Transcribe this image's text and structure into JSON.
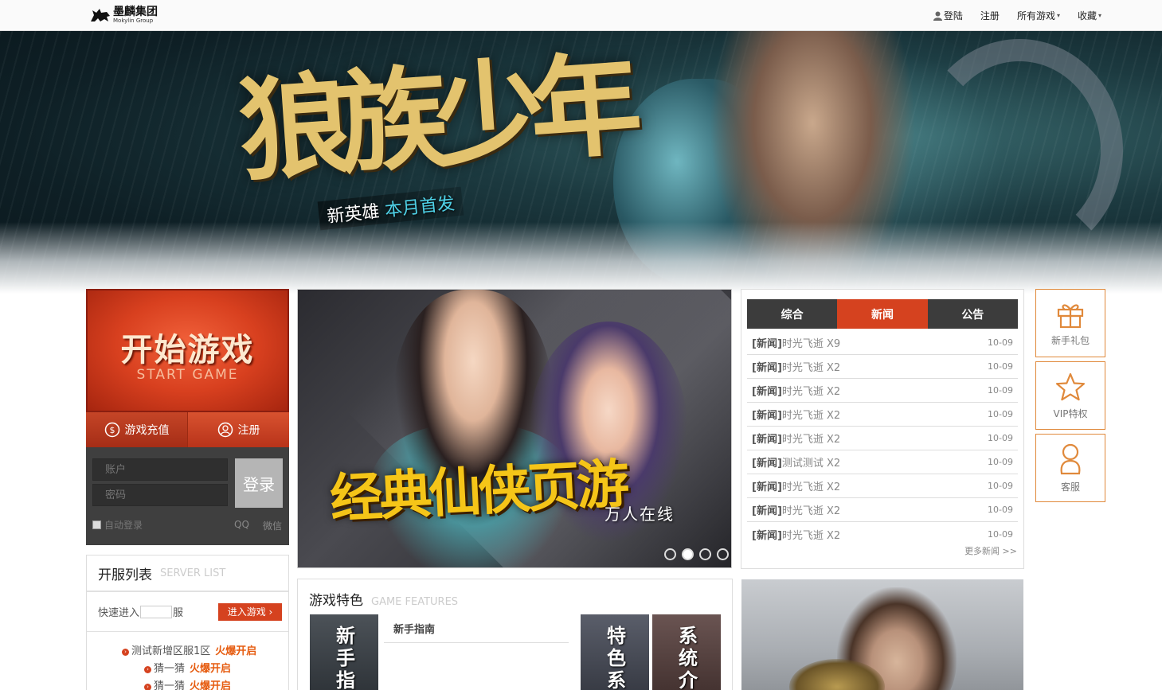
{
  "header": {
    "logo_cn": "墨麟集团",
    "logo_en": "Mokylin Group",
    "nav": {
      "login": "登陆",
      "register": "注册",
      "all_games": "所有游戏",
      "favorites": "收藏"
    }
  },
  "banner": {
    "title": "狼族少年",
    "subtitle_prefix": "新英雄",
    "subtitle_highlight": "本月首发"
  },
  "start_game": {
    "title_cn": "开始游戏",
    "title_en": "START GAME"
  },
  "quick_buttons": {
    "recharge": "游戏充值",
    "register": "注册"
  },
  "login": {
    "account_placeholder": "账户",
    "password_placeholder": "密码",
    "submit": "登录",
    "auto_login": "自动登录",
    "qq": "QQ",
    "wechat": "微信"
  },
  "server_list": {
    "title_cn": "开服列表",
    "title_en": "SERVER LIST",
    "quick_prefix": "快速进入",
    "quick_suffix": "服",
    "enter_button": "进入游戏 ›",
    "items": [
      {
        "name": "测试新增区服1区",
        "status": "火爆开启"
      },
      {
        "name": "猜一猜",
        "status": "火爆开启"
      },
      {
        "name": "猜一猜",
        "status": "火爆开启"
      }
    ]
  },
  "carousel": {
    "caption_main": "经典仙侠页游",
    "caption_sub": "万人在线",
    "slide_count": 4,
    "active_index": 1
  },
  "news": {
    "tabs": [
      "综合",
      "新闻",
      "公告"
    ],
    "active_tab": 1,
    "items": [
      {
        "tag": "[新闻]",
        "title": "时光飞逝 X9",
        "date": "10-09"
      },
      {
        "tag": "[新闻]",
        "title": "时光飞逝 X2",
        "date": "10-09"
      },
      {
        "tag": "[新闻]",
        "title": "时光飞逝 X2",
        "date": "10-09"
      },
      {
        "tag": "[新闻]",
        "title": "时光飞逝 X2",
        "date": "10-09"
      },
      {
        "tag": "[新闻]",
        "title": "时光飞逝 X2",
        "date": "10-09"
      },
      {
        "tag": "[新闻]",
        "title": "测试测试 X2",
        "date": "10-09"
      },
      {
        "tag": "[新闻]",
        "title": "时光飞逝 X2",
        "date": "10-09"
      },
      {
        "tag": "[新闻]",
        "title": "时光飞逝 X2",
        "date": "10-09"
      },
      {
        "tag": "[新闻]",
        "title": "时光飞逝 X2",
        "date": "10-09"
      }
    ],
    "more": "更多新闻 >>"
  },
  "side_icons": [
    {
      "label": "新手礼包",
      "icon": "gift-icon"
    },
    {
      "label": "VIP特权",
      "icon": "star-icon"
    },
    {
      "label": "客服",
      "icon": "customer-service-icon"
    }
  ],
  "features": {
    "title_cn": "游戏特色",
    "title_en": "GAME FEATURES",
    "tiles": [
      "新手指",
      "特色系",
      "系统介"
    ],
    "guide": "新手指南"
  },
  "colors": {
    "accent": "#d5421f",
    "side_border": "#e0893b",
    "tab_dark": "#3c3c3c",
    "hot_text": "#e65c10"
  }
}
